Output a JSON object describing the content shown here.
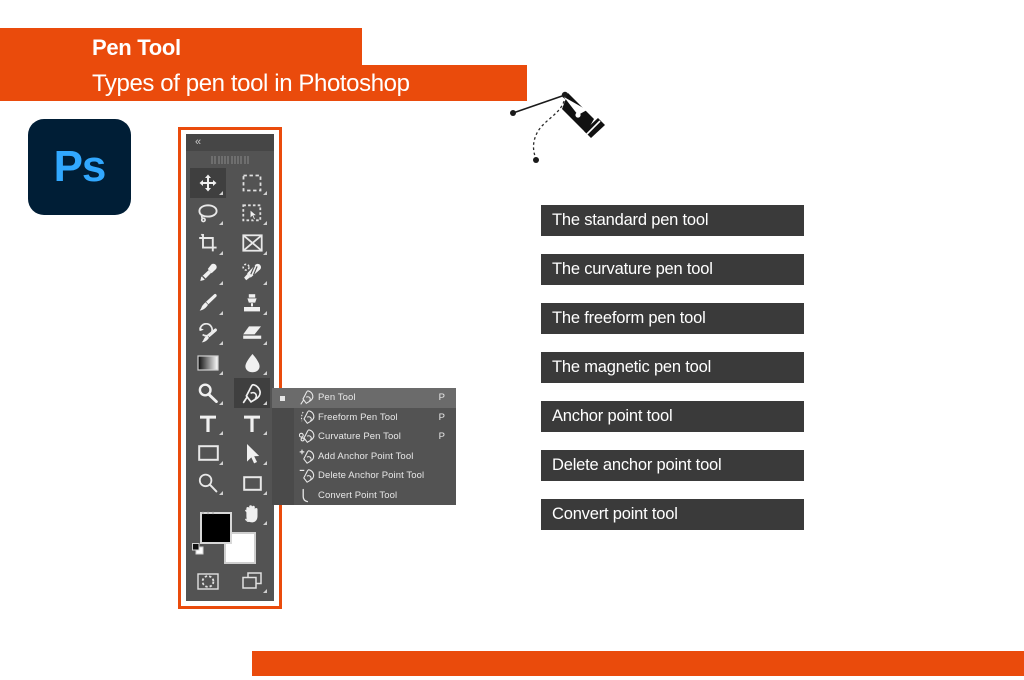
{
  "header": {
    "title": "Pen Tool",
    "subtitle": "Types of pen tool in Photoshop",
    "band_color": "#ea4b0c"
  },
  "logo": {
    "wordmark": "Ps",
    "background_color": "#001e36",
    "text_color": "#31a8ff",
    "name": "photoshop-logo"
  },
  "toolbar": {
    "collapse_glyph": "«",
    "panel_color": "#535353",
    "highlight_color": "#ea4b0c",
    "rows": [
      [
        {
          "icon": "move-tool",
          "active": true
        },
        {
          "icon": "rectangular-marquee-tool",
          "active": false
        }
      ],
      [
        {
          "icon": "lasso-tool",
          "active": false
        },
        {
          "icon": "object-selection-tool",
          "active": false
        }
      ],
      [
        {
          "icon": "crop-tool",
          "active": false
        },
        {
          "icon": "frame-tool",
          "active": false
        }
      ],
      [
        {
          "icon": "eyedropper-tool",
          "active": false
        },
        {
          "icon": "spot-healing-brush-tool",
          "active": false
        }
      ],
      [
        {
          "icon": "brush-tool",
          "active": false
        },
        {
          "icon": "clone-stamp-tool",
          "active": false
        }
      ],
      [
        {
          "icon": "history-brush-tool",
          "active": false
        },
        {
          "icon": "eraser-tool",
          "active": false
        }
      ],
      [
        {
          "icon": "gradient-tool",
          "active": false
        },
        {
          "icon": "blur-tool",
          "active": false
        }
      ],
      [
        {
          "icon": "dodge-tool",
          "active": false
        },
        {
          "icon": "pen-tool",
          "active": true
        }
      ],
      [
        {
          "icon": "horizontal-type-tool",
          "active": false
        },
        {
          "icon": "vertical-type-tool",
          "active": false
        }
      ],
      [
        {
          "icon": "rectangle-tool",
          "active": false
        },
        {
          "icon": "path-selection-tool",
          "active": false
        }
      ],
      [
        {
          "icon": "zoom-tool",
          "active": false
        },
        {
          "icon": "shape-tool",
          "active": false
        }
      ],
      [
        {
          "icon": "edit-toolbar-tool",
          "active": false
        },
        {
          "icon": "hand-tool",
          "active": false
        }
      ]
    ],
    "swatches": {
      "foreground_color": "#000000",
      "background_color": "#ffffff",
      "swap_icon": "swap-colors-icon",
      "reset_icon": "default-colors-icon"
    },
    "bottom_buttons": [
      {
        "icon": "quick-mask-icon"
      },
      {
        "icon": "screen-mode-icon"
      }
    ]
  },
  "flyout_menu": {
    "items": [
      {
        "label": "Pen Tool",
        "shortcut": "P",
        "icon": "pen-tool-icon",
        "selected": true
      },
      {
        "label": "Freeform Pen Tool",
        "shortcut": "P",
        "icon": "freeform-pen-tool-icon",
        "selected": false
      },
      {
        "label": "Curvature Pen Tool",
        "shortcut": "P",
        "icon": "curvature-pen-tool-icon",
        "selected": false
      },
      {
        "label": "Add Anchor Point Tool",
        "shortcut": "",
        "icon": "add-anchor-point-tool-icon",
        "selected": false
      },
      {
        "label": "Delete Anchor Point Tool",
        "shortcut": "",
        "icon": "delete-anchor-point-tool-icon",
        "selected": false
      },
      {
        "label": "Convert Point Tool",
        "shortcut": "",
        "icon": "convert-point-tool-icon",
        "selected": false
      }
    ]
  },
  "tool_list": {
    "bar_color": "#3a3a3a",
    "text_color": "#ffffff",
    "items": [
      {
        "label": "The standard pen tool"
      },
      {
        "label": "The curvature pen tool"
      },
      {
        "label": "The freeform pen tool"
      },
      {
        "label": "The magnetic pen tool"
      },
      {
        "label": "Anchor point tool"
      },
      {
        "label": "Delete anchor point tool"
      },
      {
        "label": "Convert point tool"
      }
    ]
  },
  "illustration": {
    "name": "pen-nib-with-bezier-path",
    "color": "#1a1a1a"
  }
}
